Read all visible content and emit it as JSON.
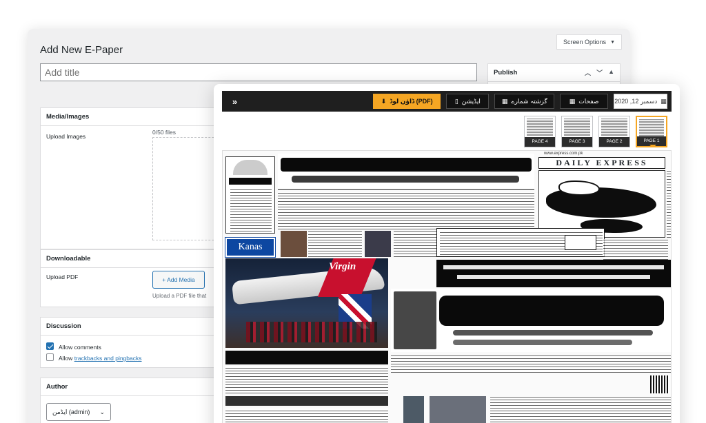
{
  "editor": {
    "page_title": "Add New E-Paper",
    "title_placeholder": "Add title",
    "screen_options": "Screen Options",
    "publish": {
      "heading": "Publish"
    },
    "media": {
      "heading": "Media/Images",
      "upload_label": "Upload Images",
      "count": "0/50 files"
    },
    "downloadable": {
      "heading": "Downloadable",
      "upload_pdf_label": "Upload PDF",
      "add_media": "+ Add Media",
      "hint": "Upload a PDF file that"
    },
    "discussion": {
      "heading": "Discussion",
      "allow_comments": "Allow comments",
      "allow_prefix": "Allow",
      "trackbacks_link": "trackbacks and pingbacks"
    },
    "author": {
      "heading": "Author",
      "selected": "ایڈمن (admin)"
    }
  },
  "viewer": {
    "toolbar": {
      "expand_glyph": "»",
      "download_pdf": "ڈاؤن لوڈ (PDF)",
      "editor": "ایڈیشن",
      "archive": "گزشتہ شمارے",
      "pages": "صفحات",
      "date": "دسمبر 12, 2020"
    },
    "pages": [
      {
        "label": "PAGE 4",
        "active": false
      },
      {
        "label": "PAGE 3",
        "active": false
      },
      {
        "label": "PAGE 2",
        "active": false
      },
      {
        "label": "PAGE 1",
        "active": true
      }
    ],
    "newspaper": {
      "url": "www.express.com.pk",
      "masthead": "DAILY EXPRESS",
      "ad_brand": "Kanas",
      "plane_brand": "Virgin"
    }
  },
  "colors": {
    "accent": "#f5a623",
    "wp_blue": "#2271b1",
    "toolbar_bg": "#1f1f1f",
    "ad_blue": "#0d47a1",
    "virgin_red": "#c8102e"
  },
  "icons": [
    "chevron-up-icon",
    "chevron-down-icon",
    "caret-up-icon",
    "expand-icon",
    "download-icon",
    "map-icon",
    "calendar-icon",
    "grid-icon"
  ]
}
